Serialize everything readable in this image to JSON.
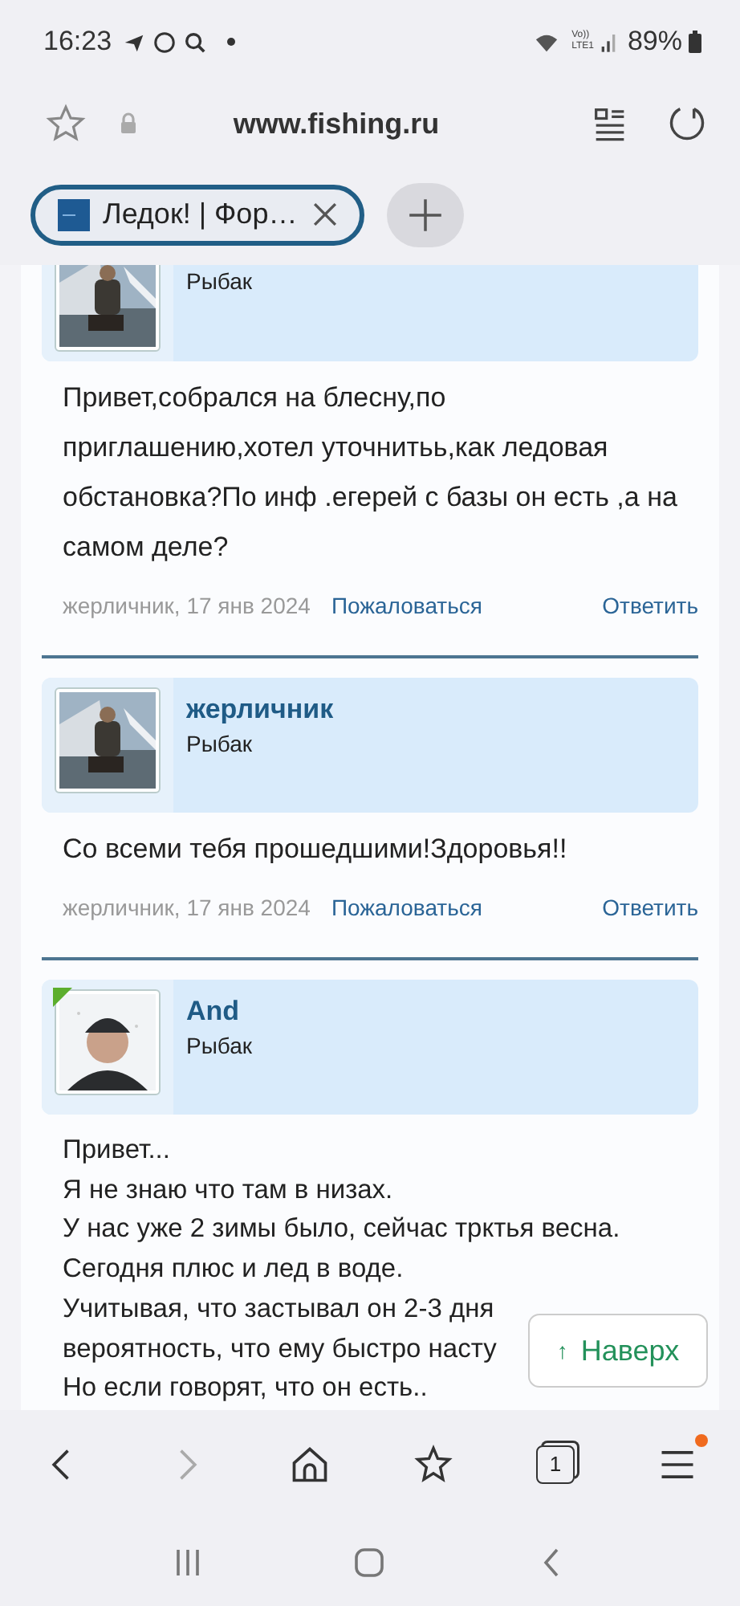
{
  "status_bar": {
    "time": "16:23",
    "network": [
      "Vo))",
      "LTE1"
    ],
    "battery": "89%"
  },
  "address_bar": {
    "url": "www.fishing.ru"
  },
  "tabs": [
    {
      "title": "Ледок! | Фор…",
      "selected": true
    }
  ],
  "posts": [
    {
      "role": "Рыбак",
      "online": false,
      "lines": [
        "Привет,собрался на блесну,по приглашению,хотел уточнитьь,как ледовая обстановка?По инф .егерей с базы он есть ,а на самом деле?"
      ],
      "meta": "жерличник, 17 янв 2024",
      "report": "Пожаловаться",
      "reply": "Ответить"
    },
    {
      "author": "жерличник",
      "role": "Рыбак",
      "online": false,
      "lines": [
        "Со всеми тебя прошедшими!Здоровья!!"
      ],
      "meta": "жерличник, 17 янв 2024",
      "report": "Пожаловаться",
      "reply": "Ответить"
    },
    {
      "author": "And",
      "role": "Рыбак",
      "online": true,
      "lines": [
        "Привет...",
        "Я не знаю что там в низах.",
        "У нас уже 2 зимы было, сейчас трктья весна.",
        "Сегодня плюс и лед в воде.",
        "Учитывая, что застывал он 2-3 дня",
        "вероятность, что ему быстро насту",
        "Но если говорят, что он есть.."
      ]
    }
  ],
  "back_to_top": {
    "arrow": "↑",
    "label": "Наверх"
  },
  "bottom_bar": {
    "forward_disabled": true,
    "tab_count": "1",
    "menu_badge": true
  }
}
